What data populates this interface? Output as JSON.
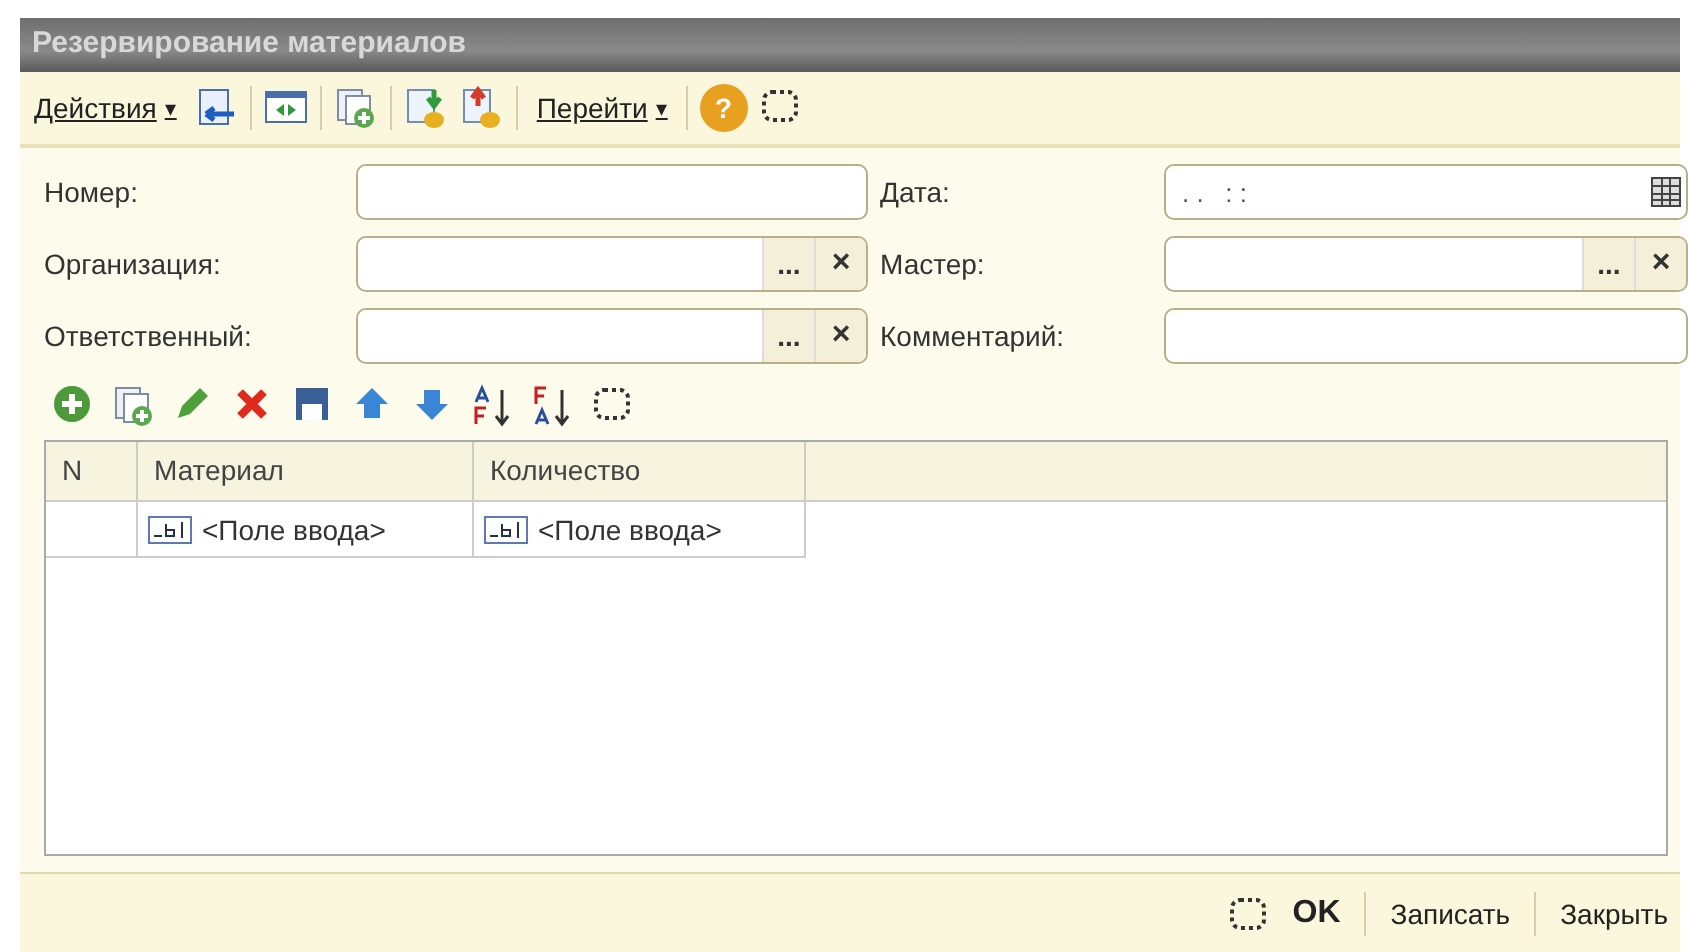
{
  "window": {
    "title": "Резервирование материалов"
  },
  "toolbar": {
    "items": [
      {
        "kind": "menu",
        "label": "Действия",
        "caret": "▾"
      },
      {
        "kind": "icon"
      },
      {
        "kind": "icon"
      },
      {
        "kind": "icon"
      },
      {
        "kind": "icon"
      },
      {
        "kind": "icon"
      },
      {
        "kind": "menu",
        "label": "Перейти",
        "caret": "▾"
      },
      {
        "kind": "help",
        "label": "?"
      },
      {
        "kind": "icon"
      }
    ]
  },
  "form": {
    "left": [
      {
        "label": "Номер:",
        "kind": "text"
      },
      {
        "label": "Организация:",
        "kind": "ref",
        "select": "...",
        "clear": "×"
      },
      {
        "label": "Ответственный:",
        "kind": "ref",
        "select": "...",
        "clear": "×"
      }
    ],
    "right": [
      {
        "label": "Дата:",
        "kind": "date",
        "value": ". .   : :"
      },
      {
        "label": "Мастер:",
        "kind": "ref",
        "select": "...",
        "clear": "×"
      },
      {
        "label": "Комментарий:",
        "kind": "text"
      }
    ]
  },
  "table": {
    "columns": [
      "N",
      "Материал",
      "Количество"
    ],
    "rows": [
      [
        "",
        "<Поле ввода>",
        "<Поле ввода>"
      ]
    ]
  },
  "footer": {
    "buttons": [
      {
        "label": "OK",
        "default": true
      },
      {
        "label": "Записать",
        "default": false
      },
      {
        "label": "Закрыть",
        "default": false
      }
    ]
  }
}
